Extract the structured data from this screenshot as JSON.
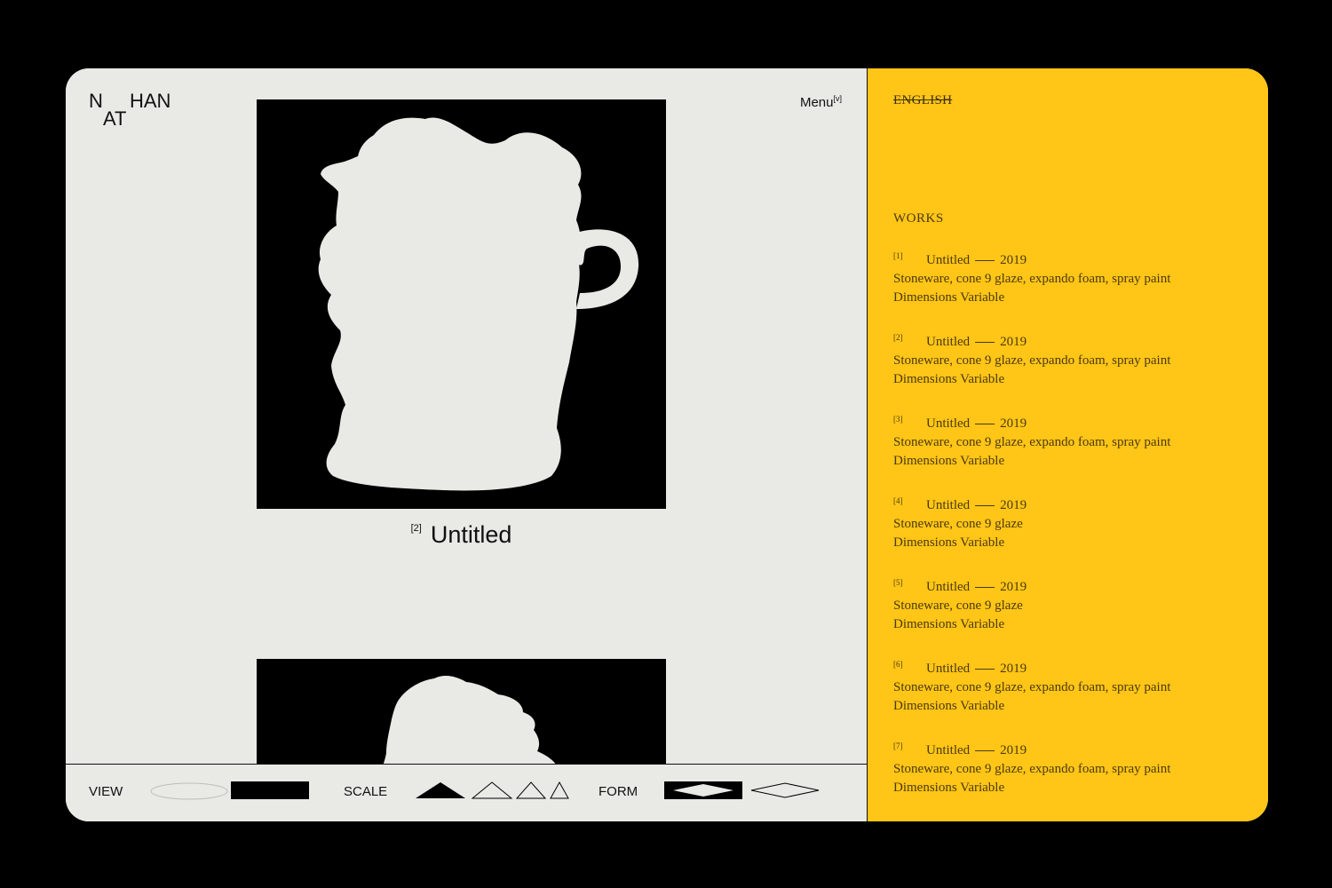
{
  "logo": {
    "part1": "N",
    "part2": "AT",
    "part3": "HAN"
  },
  "menu": {
    "label": "Menu",
    "indicator": "[v]"
  },
  "featured": {
    "number": "[2]",
    "title": "Untitled"
  },
  "toolbar": {
    "view_label": "VIEW",
    "scale_label": "SCALE",
    "form_label": "FORM",
    "view_options": [
      "ellipse-option",
      "rectangle-option"
    ],
    "scale_options": [
      "large",
      "medium",
      "small",
      "smallest"
    ],
    "form_options": [
      "rhombus-filled",
      "rhombus-outline"
    ]
  },
  "side": {
    "language": "ENGLISH",
    "works_heading": "WORKS",
    "works": [
      {
        "index": "[1]",
        "title": "Untitled",
        "year": "2019",
        "materials": "Stoneware, cone 9 glaze, expando foam, spray paint",
        "dimensions": "Dimensions Variable"
      },
      {
        "index": "[2]",
        "title": "Untitled",
        "year": "2019",
        "materials": "Stoneware, cone 9 glaze, expando foam, spray paint",
        "dimensions": "Dimensions Variable"
      },
      {
        "index": "[3]",
        "title": "Untitled",
        "year": "2019",
        "materials": "Stoneware, cone 9 glaze, expando foam, spray paint",
        "dimensions": "Dimensions Variable"
      },
      {
        "index": "[4]",
        "title": "Untitled",
        "year": "2019",
        "materials": "Stoneware, cone 9 glaze",
        "dimensions": "Dimensions Variable"
      },
      {
        "index": "[5]",
        "title": "Untitled",
        "year": "2019",
        "materials": "Stoneware, cone 9 glaze",
        "dimensions": "Dimensions Variable"
      },
      {
        "index": "[6]",
        "title": "Untitled",
        "year": "2019",
        "materials": "Stoneware, cone 9 glaze, expando foam, spray paint",
        "dimensions": "Dimensions Variable"
      },
      {
        "index": "[7]",
        "title": "Untitled",
        "year": "2019",
        "materials": "Stoneware, cone 9 glaze, expando foam, spray paint",
        "dimensions": "Dimensions Variable"
      }
    ]
  },
  "colors": {
    "accent_yellow": "#ffc517",
    "panel_bg": "#e9e9e6",
    "ink": "#111111"
  }
}
